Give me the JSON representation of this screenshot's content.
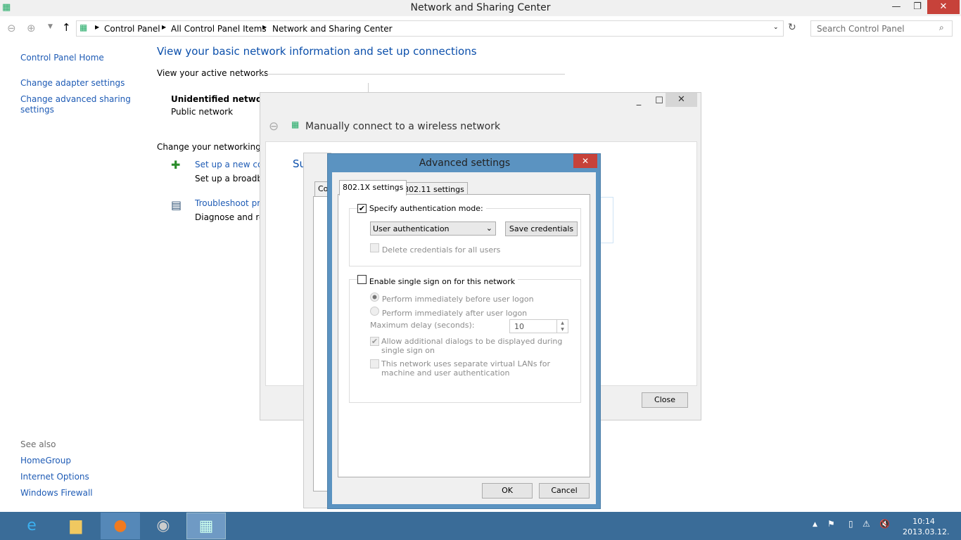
{
  "window": {
    "title": "Network and Sharing Center"
  },
  "address": {
    "crumbs": [
      "Control Panel",
      "All Control Panel Items",
      "Network and Sharing Center"
    ],
    "search_placeholder": "Search Control Panel"
  },
  "sidebar": {
    "items": [
      "Control Panel Home",
      "Change adapter settings",
      "Change advanced sharing settings"
    ],
    "see_also": "See also",
    "see_also_items": [
      "HomeGroup",
      "Internet Options",
      "Windows Firewall"
    ]
  },
  "main": {
    "heading": "View your basic network information and set up connections",
    "active_networks": "View your active networks",
    "network_name": "Unidentified network",
    "network_type": "Public network",
    "change_heading": "Change your networking se",
    "tasks": [
      {
        "link": "Set up a new conn",
        "desc": "Set up a broadbar"
      },
      {
        "link": "Troubleshoot pro",
        "desc": "Diagnose and rep"
      }
    ]
  },
  "wireless_dialog": {
    "title": "Manually connect to a wireless network",
    "partial_heading": "Su",
    "partial_tab": "Co",
    "close_label": "Close"
  },
  "advanced": {
    "title": "Advanced settings",
    "tabs": [
      "802.1X settings",
      "802.11 settings"
    ],
    "specify_auth": {
      "label": "Specify authentication mode:",
      "checked": true
    },
    "auth_mode": "User authentication",
    "save_credentials": "Save credentials",
    "delete_credentials": {
      "label": "Delete credentials for all users",
      "checked": false
    },
    "sso": {
      "label": "Enable single sign on for this network",
      "checked": false
    },
    "before_logon": {
      "label": "Perform immediately before user logon",
      "selected": true
    },
    "after_logon": {
      "label": "Perform immediately after user logon",
      "selected": false
    },
    "max_delay_label": "Maximum delay (seconds):",
    "max_delay": "10",
    "allow_dialogs": {
      "label": "Allow additional dialogs to be displayed during single sign on",
      "checked": true
    },
    "separate_vlans": {
      "label": "This network uses separate virtual LANs for machine and user authentication",
      "checked": false
    },
    "ok": "OK",
    "cancel": "Cancel"
  },
  "taskbar": {
    "time": "10:14",
    "date": "2013.03.12.",
    "color": "#3a6c98"
  }
}
